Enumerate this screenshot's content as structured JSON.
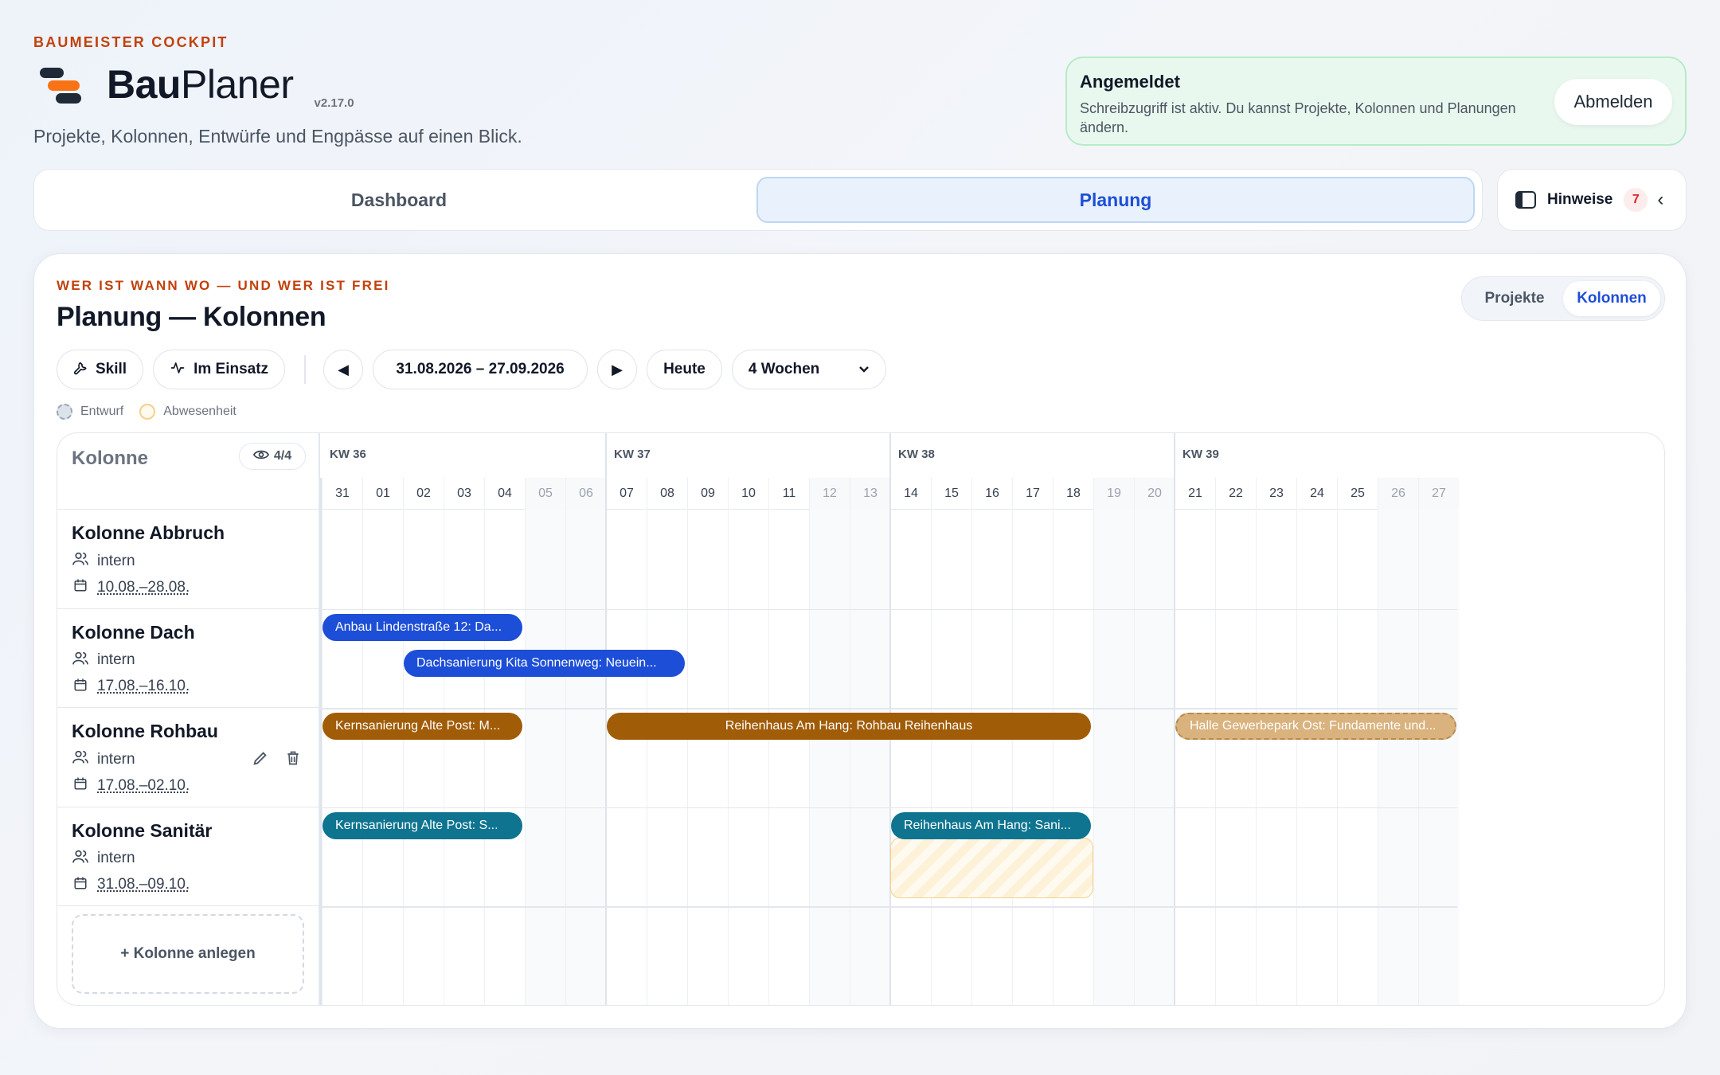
{
  "header": {
    "eyebrow": "BAUMEISTER COCKPIT",
    "brand_bold": "Bau",
    "brand_light": "Planer",
    "version": "v2.17.0",
    "tagline": "Projekte, Kolonnen, Entwürfe und Engpässe auf einen Blick."
  },
  "login": {
    "title": "Angemeldet",
    "text": "Schreibzugriff ist aktiv. Du kannst Projekte, Kolonnen und Planungen ändern.",
    "logout_label": "Abmelden"
  },
  "tabs": [
    {
      "label": "Dashboard",
      "active": false
    },
    {
      "label": "Planung",
      "active": true
    }
  ],
  "hints": {
    "label": "Hinweise",
    "count": "7"
  },
  "planning": {
    "eyebrow": "WER IST WANN WO — UND WER IST FREI",
    "title": "Planung — Kolonnen",
    "view_toggle": [
      {
        "label": "Projekte",
        "active": false
      },
      {
        "label": "Kolonnen",
        "active": true
      }
    ],
    "toolbar": {
      "skill_label": "Skill",
      "in_use_label": "Im Einsatz",
      "prev_icon": "◀",
      "date_range": "31.08.2026 – 27.09.2026",
      "next_icon": "▶",
      "today_label": "Heute",
      "range_select": "4 Wochen"
    },
    "legend": {
      "draft": "Entwurf",
      "absence": "Abwesenheit"
    }
  },
  "gantt": {
    "column_header": "Kolonne",
    "visible_count": "4/4",
    "weeks": [
      "KW 36",
      "KW 37",
      "KW 38",
      "KW 39"
    ],
    "days": [
      "31",
      "01",
      "02",
      "03",
      "04",
      "05",
      "06",
      "07",
      "08",
      "09",
      "10",
      "11",
      "12",
      "13",
      "14",
      "15",
      "16",
      "17",
      "18",
      "19",
      "20",
      "21",
      "22",
      "23",
      "24",
      "25",
      "26",
      "27"
    ],
    "weekend_days": [
      5,
      6,
      12,
      13,
      19,
      20,
      26,
      27
    ],
    "crews": [
      {
        "name": "Kolonne Abbruch",
        "type": "intern",
        "period": "10.08.–28.08."
      },
      {
        "name": "Kolonne Dach",
        "type": "intern",
        "period": "17.08.–16.10."
      },
      {
        "name": "Kolonne Rohbau",
        "type": "intern",
        "period": "17.08.–02.10."
      },
      {
        "name": "Kolonne Sanitär",
        "type": "intern",
        "period": "31.08.–09.10."
      }
    ],
    "add_crew_label": "+ Kolonne anlegen",
    "assignments": [
      {
        "crew": 1,
        "lane": 0,
        "start": 0,
        "end": 4,
        "label": "Anbau Lindenstraße 12: Da...",
        "color": "blue"
      },
      {
        "crew": 1,
        "lane": 1,
        "start": 2,
        "end": 8,
        "label": "Dachsanierung Kita Sonnenweg: Neuein...",
        "color": "blue"
      },
      {
        "crew": 2,
        "lane": 0,
        "start": 0,
        "end": 4,
        "label": "Kernsanierung Alte Post: M...",
        "color": "brown"
      },
      {
        "crew": 2,
        "lane": 0,
        "start": 7,
        "end": 18,
        "label": "Reihenhaus Am Hang: Rohbau Reihenhaus",
        "color": "brown",
        "center": true
      },
      {
        "crew": 2,
        "lane": 0,
        "start": 21,
        "end": 27,
        "label": "Halle Gewerbepark Ost: Fundamente und...",
        "color": "draft"
      },
      {
        "crew": 3,
        "lane": 0,
        "start": 0,
        "end": 4,
        "label": "Kernsanierung Alte Post: S...",
        "color": "teal"
      },
      {
        "crew": 3,
        "lane": 0,
        "start": 14,
        "end": 18,
        "label": "Reihenhaus Am Hang: Sani...",
        "color": "teal"
      }
    ],
    "absences": [
      {
        "crew": 3,
        "start": 14,
        "end": 18
      }
    ]
  },
  "colors": {
    "accent": "#1d4ed8",
    "eyebrow": "#c2410c",
    "bar_blue": "#1d4ed8",
    "bar_brown": "#a15c07",
    "bar_teal": "#0e7490",
    "bar_draft": "#d9b27e"
  }
}
